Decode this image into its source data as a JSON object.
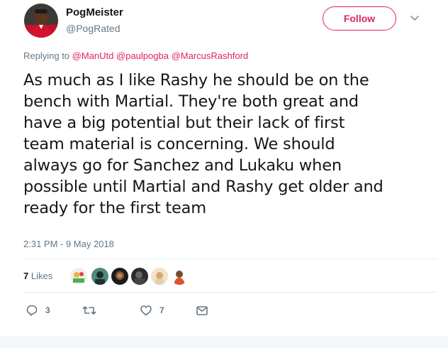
{
  "author": {
    "display_name": "PogMeister",
    "handle": "@PogRated",
    "avatar_icon": "profile-photo-red-kit"
  },
  "follow_button": {
    "label": "Follow"
  },
  "replying": {
    "prefix": "Replying to",
    "mentions": [
      "@ManUtd",
      "@paulpogba",
      "@MarcusRashford"
    ]
  },
  "tweet": {
    "lines": [
      "As much as I like Rashy he should be on the",
      "bench with Martial. They're both great and",
      "have a big potential but their lack of first",
      "team material is concerning. We should",
      "always go for Sanchez and Lukaku when",
      "possible until Martial and Rashy get older and",
      "ready for the first team"
    ],
    "timestamp": "2:31 PM - 9 May 2018"
  },
  "stats": {
    "likes_number": "7",
    "likes_label": "Likes"
  },
  "actions": {
    "reply_count": "3",
    "retweet_count": "",
    "like_count": "7"
  },
  "colors": {
    "accent": "#e0245e",
    "secondary_text": "#657786",
    "divider": "#e6ecf0"
  }
}
